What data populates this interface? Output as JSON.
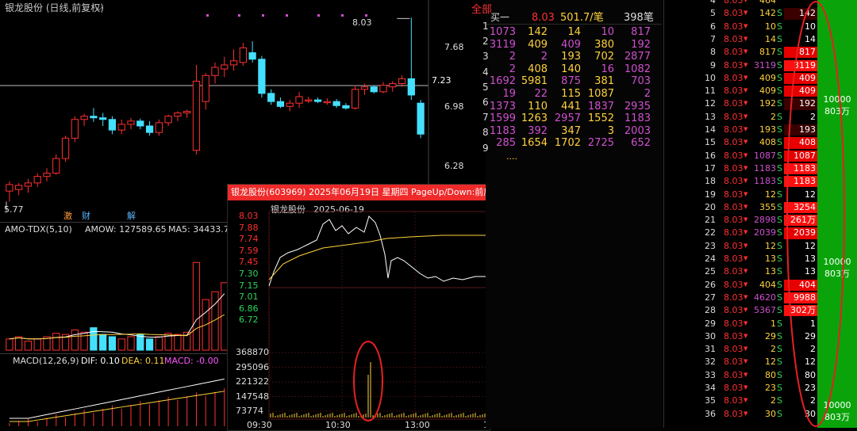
{
  "main_chart": {
    "title": "银龙股份 (日线,前复权)",
    "high_label": "8.03",
    "low_label": "5.77",
    "price_labels": [
      "7.68",
      "6.98",
      "6.28"
    ],
    "current_price": "7.23",
    "event_markers": [
      "激",
      "财",
      "解"
    ],
    "candles": [
      {
        "o": 5.9,
        "h": 6.02,
        "l": 5.77,
        "c": 5.98
      },
      {
        "o": 5.92,
        "h": 6.0,
        "l": 5.85,
        "c": 5.97
      },
      {
        "o": 5.96,
        "h": 6.05,
        "l": 5.88,
        "c": 6.0
      },
      {
        "o": 6.0,
        "h": 6.12,
        "l": 5.95,
        "c": 6.08
      },
      {
        "o": 6.08,
        "h": 6.18,
        "l": 6.02,
        "c": 6.12
      },
      {
        "o": 6.12,
        "h": 6.35,
        "l": 6.1,
        "c": 6.3
      },
      {
        "o": 6.3,
        "h": 6.58,
        "l": 6.26,
        "c": 6.55
      },
      {
        "o": 6.55,
        "h": 6.82,
        "l": 6.5,
        "c": 6.78
      },
      {
        "o": 6.78,
        "h": 6.85,
        "l": 6.7,
        "c": 6.82
      },
      {
        "o": 6.82,
        "h": 6.92,
        "l": 6.75,
        "c": 6.8
      },
      {
        "o": 6.8,
        "h": 6.86,
        "l": 6.7,
        "c": 6.78
      },
      {
        "o": 6.78,
        "h": 6.82,
        "l": 6.6,
        "c": 6.65
      },
      {
        "o": 6.65,
        "h": 6.78,
        "l": 6.6,
        "c": 6.72
      },
      {
        "o": 6.72,
        "h": 6.8,
        "l": 6.66,
        "c": 6.76
      },
      {
        "o": 6.76,
        "h": 6.79,
        "l": 6.66,
        "c": 6.7
      },
      {
        "o": 6.7,
        "h": 6.76,
        "l": 6.58,
        "c": 6.62
      },
      {
        "o": 6.62,
        "h": 6.78,
        "l": 6.58,
        "c": 6.74
      },
      {
        "o": 6.74,
        "h": 6.84,
        "l": 6.7,
        "c": 6.82
      },
      {
        "o": 6.82,
        "h": 6.88,
        "l": 6.76,
        "c": 6.86
      },
      {
        "o": 6.86,
        "h": 6.9,
        "l": 6.8,
        "c": 6.88
      },
      {
        "o": 6.4,
        "h": 7.45,
        "l": 6.35,
        "c": 7.25
      },
      {
        "o": 7.0,
        "h": 7.35,
        "l": 6.9,
        "c": 7.32
      },
      {
        "o": 7.32,
        "h": 7.48,
        "l": 7.22,
        "c": 7.42
      },
      {
        "o": 7.4,
        "h": 7.55,
        "l": 7.3,
        "c": 7.45
      },
      {
        "o": 7.45,
        "h": 7.64,
        "l": 7.38,
        "c": 7.5
      },
      {
        "o": 7.48,
        "h": 7.72,
        "l": 7.44,
        "c": 7.66
      },
      {
        "o": 7.6,
        "h": 7.74,
        "l": 7.48,
        "c": 7.52
      },
      {
        "o": 7.52,
        "h": 7.56,
        "l": 7.05,
        "c": 7.1
      },
      {
        "o": 7.1,
        "h": 7.15,
        "l": 6.96,
        "c": 7.0
      },
      {
        "o": 7.0,
        "h": 7.05,
        "l": 6.92,
        "c": 6.94
      },
      {
        "o": 6.94,
        "h": 7.02,
        "l": 6.88,
        "c": 6.98
      },
      {
        "o": 6.98,
        "h": 7.12,
        "l": 6.92,
        "c": 7.06
      },
      {
        "o": 7.02,
        "h": 7.06,
        "l": 6.98,
        "c": 7.02
      },
      {
        "o": 7.02,
        "h": 7.05,
        "l": 6.98,
        "c": 7.0
      },
      {
        "o": 7.0,
        "h": 7.04,
        "l": 6.96,
        "c": 7.0
      },
      {
        "o": 7.0,
        "h": 7.03,
        "l": 6.92,
        "c": 6.95
      },
      {
        "o": 6.95,
        "h": 6.98,
        "l": 6.9,
        "c": 6.92
      },
      {
        "o": 6.92,
        "h": 7.2,
        "l": 6.9,
        "c": 7.15
      },
      {
        "o": 7.15,
        "h": 7.22,
        "l": 7.08,
        "c": 7.18
      },
      {
        "o": 7.18,
        "h": 7.2,
        "l": 7.1,
        "c": 7.12
      },
      {
        "o": 7.12,
        "h": 7.24,
        "l": 7.1,
        "c": 7.2
      },
      {
        "o": 7.18,
        "h": 7.25,
        "l": 7.12,
        "c": 7.22
      },
      {
        "o": 7.22,
        "h": 7.32,
        "l": 7.18,
        "c": 7.28
      },
      {
        "o": 7.28,
        "h": 8.03,
        "l": 7.02,
        "c": 7.08
      },
      {
        "o": 6.98,
        "h": 7.02,
        "l": 6.55,
        "c": 6.6
      }
    ]
  },
  "amo_panel": {
    "title": "AMO-TDX(5,10)",
    "amo": "AMOW: 127589.65",
    "ma5": "MA5: 34433.73",
    "bars": [
      0.1,
      0.12,
      0.08,
      0.1,
      0.12,
      0.15,
      0.14,
      0.18,
      0.16,
      0.2,
      0.14,
      0.12,
      0.1,
      0.12,
      0.14,
      0.1,
      0.12,
      0.15,
      0.14,
      0.16,
      0.78,
      0.45,
      0.52,
      0.6,
      0.48,
      0.62,
      0.58,
      0.4,
      0.3,
      0.25,
      0.22,
      0.28,
      0.2,
      0.18,
      0.16,
      0.22,
      0.2,
      0.3,
      0.26,
      0.22,
      0.24,
      0.2,
      0.26,
      0.95,
      0.6
    ],
    "colors": {
      "up": "#ff3030",
      "down": "#44e0ff"
    }
  },
  "macd_panel": {
    "title": "MACD(12,26,9)",
    "dif": "DIF: 0.10",
    "dea": "DEA: 0.11",
    "macd": "MACD: -0.00"
  },
  "intraday": {
    "header": "银龙股份(603969) 2025年06月19日 星期四 PageUp/Down:前后日",
    "subtitle": "银龙股份",
    "date": "2025-06-19",
    "price_axis": [
      "8.03",
      "7.88",
      "7.74",
      "7.59",
      "7.45",
      "7.30",
      "7.15",
      "7.01",
      "6.86",
      "6.72"
    ],
    "volume_axis": [
      "368870",
      "295096",
      "221322",
      "147548",
      "73774"
    ],
    "time_axis": [
      "09:30",
      "10:30",
      "13:00",
      "1"
    ]
  },
  "order_book": {
    "tab_label": "全部",
    "side_label": "买一",
    "price": "8.03",
    "volume": "501.7/笔",
    "count": "398笔",
    "rows": [
      [
        "1073",
        "142",
        "14",
        "10",
        "817"
      ],
      [
        "3119",
        "409",
        "409",
        "380",
        "192"
      ],
      [
        "2",
        "2",
        "193",
        "702",
        "2877"
      ],
      [
        "2",
        "408",
        "140",
        "16",
        "1082"
      ],
      [
        "1692",
        "5981",
        "875",
        "381",
        "703"
      ],
      [
        "19",
        "22",
        "115",
        "1087",
        "2"
      ],
      [
        "1373",
        "110",
        "441",
        "1837",
        "2935"
      ],
      [
        "1599",
        "1263",
        "2957",
        "1552",
        "1183"
      ],
      [
        "1183",
        "392",
        "347",
        "3",
        "2003"
      ],
      [
        "285",
        "1654",
        "1702",
        "2725",
        "652"
      ]
    ],
    "more": "....",
    "row_index": [
      "1",
      "2",
      "3",
      "4",
      "5",
      "6",
      "7",
      "8",
      "9"
    ]
  },
  "ticks": {
    "rows": [
      {
        "n": "4",
        "p": "8.03",
        "v": "464",
        "s": "",
        "bar": ""
      },
      {
        "n": "5",
        "p": "8.03",
        "v": "142",
        "s": "S",
        "bar": "142"
      },
      {
        "n": "6",
        "p": "8.03",
        "v": "10",
        "s": "S",
        "bar": "10"
      },
      {
        "n": "7",
        "p": "8.03",
        "v": "14",
        "s": "S",
        "bar": "14"
      },
      {
        "n": "8",
        "p": "8.03",
        "v": "817",
        "s": "S",
        "bar": "817"
      },
      {
        "n": "9",
        "p": "8.03",
        "v": "3119",
        "s": "S",
        "bar": "3119"
      },
      {
        "n": "10",
        "p": "8.03",
        "v": "409",
        "s": "S",
        "bar": "409"
      },
      {
        "n": "11",
        "p": "8.03",
        "v": "409",
        "s": "S",
        "bar": "409"
      },
      {
        "n": "12",
        "p": "8.03",
        "v": "192",
        "s": "S",
        "bar": "192"
      },
      {
        "n": "13",
        "p": "8.03",
        "v": "2",
        "s": "S",
        "bar": "2"
      },
      {
        "n": "14",
        "p": "8.03",
        "v": "193",
        "s": "S",
        "bar": "193"
      },
      {
        "n": "15",
        "p": "8.03",
        "v": "408",
        "s": "S",
        "bar": "408"
      },
      {
        "n": "16",
        "p": "8.03",
        "v": "1087",
        "s": "S",
        "bar": "1087"
      },
      {
        "n": "17",
        "p": "8.03",
        "v": "1183",
        "s": "S",
        "bar": "1183"
      },
      {
        "n": "18",
        "p": "8.03",
        "v": "1183",
        "s": "S",
        "bar": "1183"
      },
      {
        "n": "19",
        "p": "8.03",
        "v": "12",
        "s": "S",
        "bar": "12"
      },
      {
        "n": "20",
        "p": "8.03",
        "v": "355",
        "s": "S",
        "bar": "3254"
      },
      {
        "n": "21",
        "p": "8.03",
        "v": "2898",
        "s": "S",
        "bar": "261万"
      },
      {
        "n": "22",
        "p": "8.03",
        "v": "2039",
        "s": "S",
        "bar": "2039"
      },
      {
        "n": "23",
        "p": "8.03",
        "v": "12",
        "s": "S",
        "bar": "12"
      },
      {
        "n": "24",
        "p": "8.03",
        "v": "13",
        "s": "S",
        "bar": "13"
      },
      {
        "n": "25",
        "p": "8.03",
        "v": "13",
        "s": "S",
        "bar": "13"
      },
      {
        "n": "26",
        "p": "8.03",
        "v": "404",
        "s": "S",
        "bar": "404"
      },
      {
        "n": "27",
        "p": "8.03",
        "v": "4620",
        "s": "S",
        "bar": "9988"
      },
      {
        "n": "28",
        "p": "8.03",
        "v": "5367",
        "s": "S",
        "bar": "302万"
      },
      {
        "n": "29",
        "p": "8.03",
        "v": "1",
        "s": "S",
        "bar": "1"
      },
      {
        "n": "30",
        "p": "8.03",
        "v": "29",
        "s": "S",
        "bar": "29"
      },
      {
        "n": "31",
        "p": "8.03",
        "v": "2",
        "s": "S",
        "bar": "2"
      },
      {
        "n": "32",
        "p": "8.03",
        "v": "12",
        "s": "S",
        "bar": "12"
      },
      {
        "n": "33",
        "p": "8.03",
        "v": "80",
        "s": "S",
        "bar": "80"
      },
      {
        "n": "34",
        "p": "8.03",
        "v": "23",
        "s": "S",
        "bar": "23"
      },
      {
        "n": "35",
        "p": "8.03",
        "v": "2",
        "s": "S",
        "bar": "2"
      },
      {
        "n": "36",
        "p": "8.03",
        "v": "30",
        "s": "S",
        "bar": "30"
      }
    ],
    "green_labels": [
      {
        "a": "10000",
        "b": "803万"
      },
      {
        "a": "10000",
        "b": "803万"
      },
      {
        "a": "10000",
        "b": "803万"
      }
    ]
  }
}
